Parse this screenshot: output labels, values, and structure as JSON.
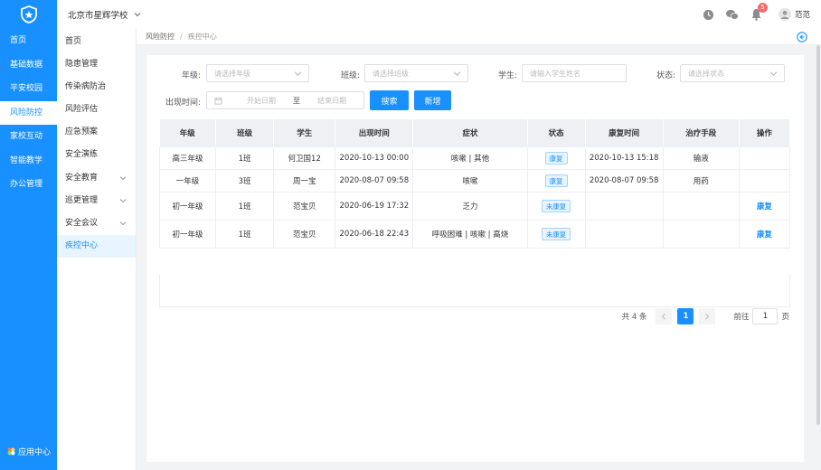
{
  "sidebar": {
    "items": [
      {
        "label": "首页"
      },
      {
        "label": "基础数据"
      },
      {
        "label": "平安校园"
      },
      {
        "label": "风险防控",
        "active": true
      },
      {
        "label": "家校互动"
      },
      {
        "label": "智能教学"
      },
      {
        "label": "办公管理"
      }
    ],
    "app_center": "应用中心"
  },
  "header": {
    "school": "北京市星辉学校",
    "notifications": "5",
    "user": "范范"
  },
  "submenu": {
    "items": [
      {
        "label": "首页"
      },
      {
        "label": "隐患管理"
      },
      {
        "label": "传染病防治"
      },
      {
        "label": "风险评估"
      },
      {
        "label": "应急预案"
      },
      {
        "label": "安全演练"
      },
      {
        "label": "安全教育",
        "chevron": true
      },
      {
        "label": "巡更管理",
        "chevron": true
      },
      {
        "label": "安全会议",
        "chevron": true
      },
      {
        "label": "疾控中心",
        "active": true
      }
    ]
  },
  "breadcrumb": {
    "parent": "风险防控",
    "sep": "/",
    "current": "疾控中心"
  },
  "filters": {
    "grade": {
      "label": "年级:",
      "placeholder": "请选择年级"
    },
    "class": {
      "label": "班级:",
      "placeholder": "请选择班级"
    },
    "student": {
      "label": "学生:",
      "placeholder": "请输入学生姓名"
    },
    "status": {
      "label": "状态:",
      "placeholder": "请选择状态"
    },
    "time": {
      "label": "出现时间:",
      "start": "开始日期",
      "to": "至",
      "end": "结束日期"
    },
    "search": "搜索",
    "add": "新增"
  },
  "table": {
    "columns": [
      "年级",
      "班级",
      "学生",
      "出现时间",
      "症状",
      "状态",
      "康复时间",
      "治疗手段",
      "操作"
    ],
    "rows": [
      {
        "grade": "高三年级",
        "class": "1班",
        "student": "何卫国12",
        "time": "2020-10-13 00:00",
        "symptom": "咳嗽 | 其他",
        "status": "康复",
        "recover": "2020-10-13 15:18",
        "treat": "输液",
        "op": ""
      },
      {
        "grade": "一年级",
        "class": "3班",
        "student": "周一宝",
        "time": "2020-08-07 09:58",
        "symptom": "咳嗽",
        "status": "康复",
        "recover": "2020-08-07 09:58",
        "treat": "用药",
        "op": ""
      },
      {
        "grade": "初一年级",
        "class": "1班",
        "student": "范宝贝",
        "time": "2020-06-19 17:32",
        "symptom": "乏力",
        "status": "未康复",
        "recover": "",
        "treat": "",
        "op": "康复"
      },
      {
        "grade": "初一年级",
        "class": "1班",
        "student": "范宝贝",
        "time": "2020-06-18 22:43",
        "symptom": "呼吸困难 | 咳嗽 | 高烧",
        "status": "未康复",
        "recover": "",
        "treat": "",
        "op": "康复"
      }
    ]
  },
  "pager": {
    "total": "共 4 条",
    "page": "1",
    "goto": "前往",
    "goto_value": "1",
    "suffix": "页"
  },
  "colors": {
    "primary": "#1890ff"
  }
}
